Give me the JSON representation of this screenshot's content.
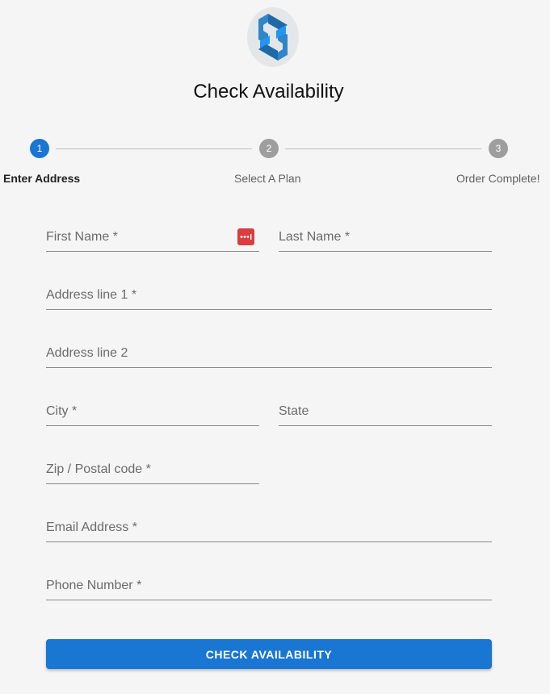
{
  "page": {
    "title": "Check Availability"
  },
  "colors": {
    "primary": "#1976d2",
    "inactive_step": "#9e9e9e",
    "password_manager": "#d93d3d"
  },
  "stepper": {
    "steps": [
      {
        "number": "1",
        "label": "Enter Address",
        "state": "active"
      },
      {
        "number": "2",
        "label": "Select A Plan",
        "state": "inactive"
      },
      {
        "number": "3",
        "label": "Order Complete!",
        "state": "inactive"
      }
    ]
  },
  "form": {
    "first_name": {
      "label": "First Name *"
    },
    "last_name": {
      "label": "Last Name *"
    },
    "address_line_1": {
      "label": "Address line 1 *"
    },
    "address_line_2": {
      "label": "Address line 2"
    },
    "city": {
      "label": "City *"
    },
    "state": {
      "label": "State"
    },
    "zip": {
      "label": "Zip / Postal code *"
    },
    "email": {
      "label": "Email Address *"
    },
    "phone": {
      "label": "Phone Number *"
    },
    "submit_label": "CHECK AVAILABILITY"
  },
  "icons": {
    "logo": "brand-logo-icon",
    "password_manager": "password-manager-icon"
  }
}
